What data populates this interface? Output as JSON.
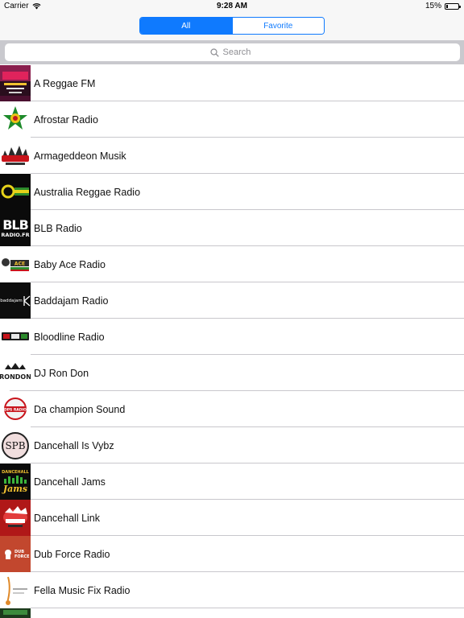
{
  "status_bar": {
    "carrier": "Carrier",
    "time": "9:28 AM",
    "battery": "15%",
    "battery_level": 0.15
  },
  "nav": {
    "segments": [
      {
        "label": "All",
        "selected": true
      },
      {
        "label": "Favorite",
        "selected": false
      }
    ]
  },
  "search": {
    "placeholder": "Search"
  },
  "stations": [
    {
      "name": "A Reggae FM",
      "icon": "a-reggae-fm-logo"
    },
    {
      "name": "Afrostar Radio",
      "icon": "afrostar-logo"
    },
    {
      "name": "Armageddeon Musik",
      "icon": "armageddeon-logo"
    },
    {
      "name": "Australia Reggae Radio",
      "icon": "australia-reggae-logo"
    },
    {
      "name": "BLB Radio",
      "icon": "blb-logo"
    },
    {
      "name": "Baby Ace Radio",
      "icon": "baby-ace-logo"
    },
    {
      "name": "Baddajam Radio",
      "icon": "baddajam-logo"
    },
    {
      "name": "Bloodline Radio",
      "icon": "bloodline-logo"
    },
    {
      "name": "DJ Ron Don",
      "icon": "ron-don-logo"
    },
    {
      "name": "Da champion Sound",
      "icon": "champion-sound-logo"
    },
    {
      "name": "Dancehall Is Vybz",
      "icon": "spb-logo"
    },
    {
      "name": "Dancehall Jams",
      "icon": "dancehall-jams-logo"
    },
    {
      "name": "Dancehall Link",
      "icon": "dancehall-link-logo"
    },
    {
      "name": "Dub Force Radio",
      "icon": "dub-force-logo"
    },
    {
      "name": "Fella Music Fix Radio",
      "icon": "fella-music-logo"
    },
    {
      "name": "",
      "icon": "partial-logo"
    }
  ],
  "logo_text": {
    "blb_top": "BLB",
    "blb_bottom": "RADIO.FR",
    "spb": "SPB",
    "dancehall": "DANCEHALL",
    "jams": "Jams",
    "baddajam": "baddajam",
    "dub_force": "DUB FORCE",
    "ron_don": "RONDON",
    "dps": "DPS RADIO",
    "ace": "ACE"
  },
  "colors": {
    "accent": "#0f7afe",
    "separator": "#c8c7cc",
    "search_bg": "#c9c9ce"
  }
}
